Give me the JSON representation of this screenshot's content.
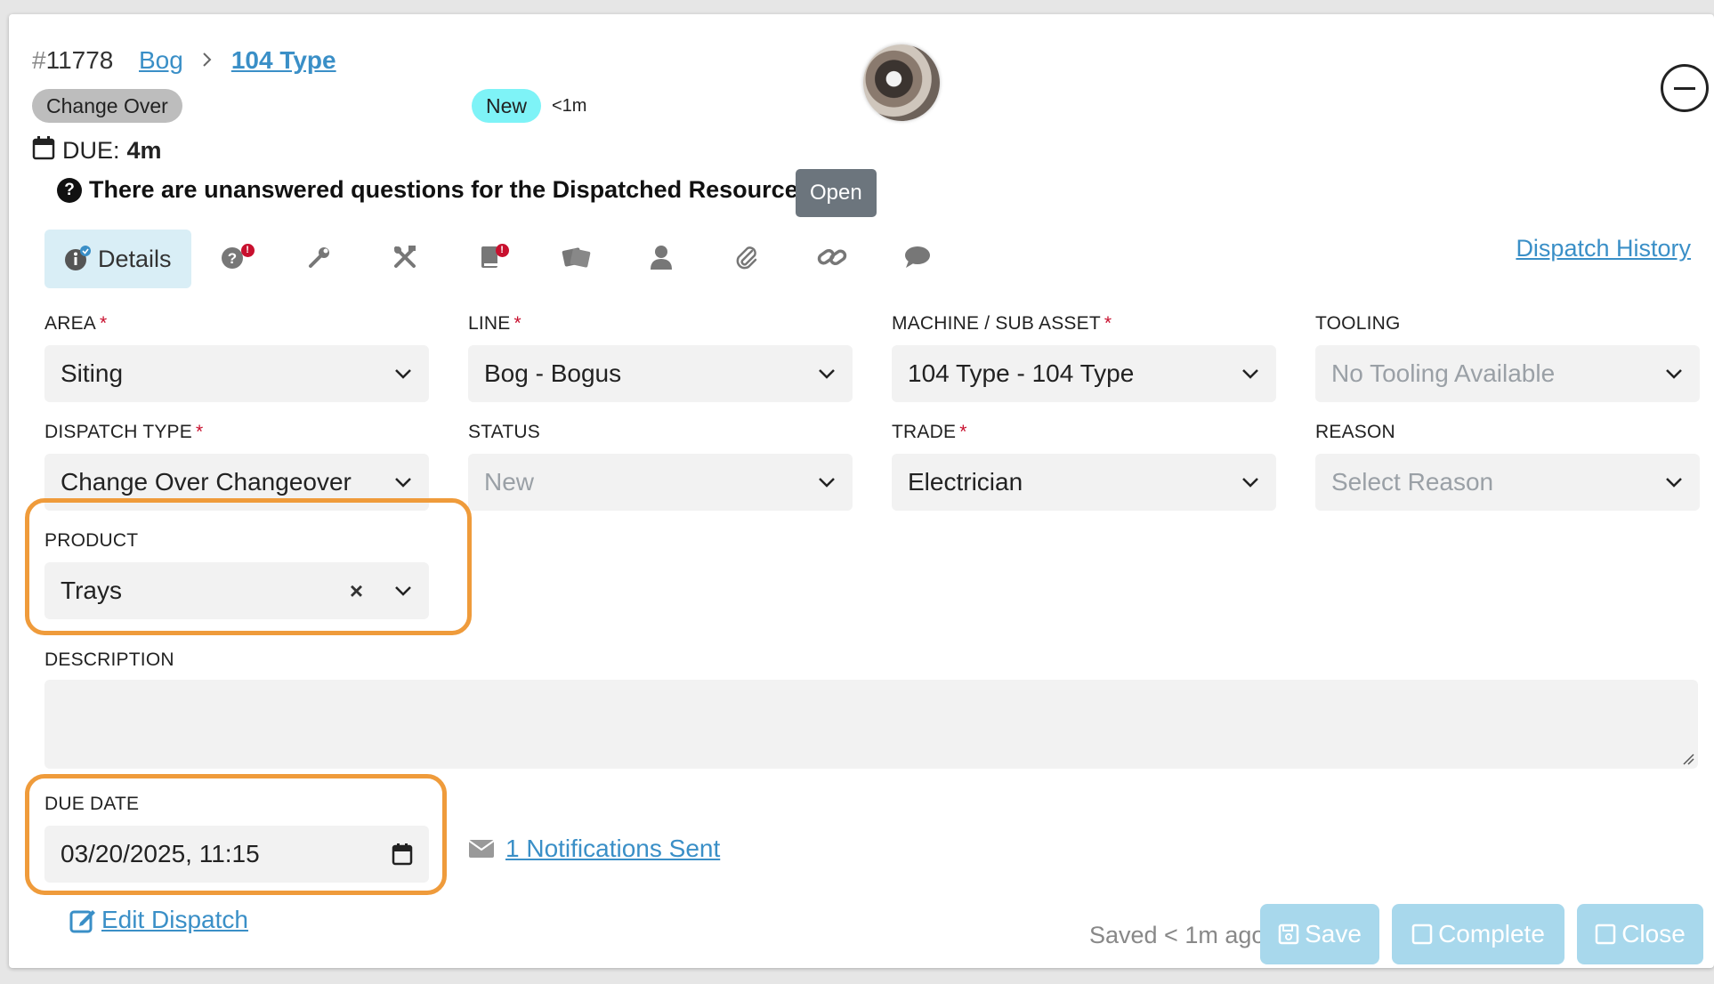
{
  "header": {
    "id_hash": "#",
    "id_number": "11778",
    "breadcrumb": [
      "Bog",
      "104 Type"
    ],
    "type_badge": "Change Over",
    "status_badge": "New",
    "age": "<1m",
    "due_label": "DUE:",
    "due_value": "4m"
  },
  "warning": {
    "text": "There are unanswered questions for the Dispatched Resource.",
    "button": "Open"
  },
  "tabs": {
    "active_label": "Details",
    "icons": [
      "question-icon",
      "wrench-icon",
      "tools-icon",
      "book-icon",
      "tickets-icon",
      "user-icon",
      "paperclip-icon",
      "link-icon",
      "comment-icon"
    ],
    "dispatch_history": "Dispatch History"
  },
  "fields": {
    "area": {
      "label": "AREA",
      "value": "Siting",
      "required": "*"
    },
    "line": {
      "label": "LINE",
      "value": "Bog - Bogus",
      "required": "*"
    },
    "machine": {
      "label": "MACHINE / SUB ASSET",
      "value": "104 Type - 104 Type",
      "required": "*"
    },
    "tooling": {
      "label": "TOOLING",
      "value": "No Tooling Available"
    },
    "dispatch_type": {
      "label": "DISPATCH TYPE",
      "value": "Change Over Changeover",
      "required": "*"
    },
    "status": {
      "label": "STATUS",
      "value": "New"
    },
    "trade": {
      "label": "TRADE",
      "value": "Electrician",
      "required": "*"
    },
    "reason": {
      "label": "REASON",
      "placeholder": "Select Reason"
    },
    "product": {
      "label": "PRODUCT",
      "value": "Trays",
      "clear": "×"
    },
    "description": {
      "label": "DESCRIPTION",
      "value": ""
    },
    "due_date": {
      "label": "DUE DATE",
      "value": "03/20/2025, 11:15"
    }
  },
  "notifications": "1 Notifications Sent",
  "footer": {
    "edit": "Edit Dispatch",
    "saved": "Saved < 1m ago",
    "save": "Save",
    "complete": "Complete",
    "close": "Close"
  },
  "colors": {
    "link": "#3a8fc7",
    "highlight": "#ef9b3b",
    "new_badge": "#7ef3f7",
    "button_light": "#a8d8ec",
    "required": "#c8102e"
  }
}
